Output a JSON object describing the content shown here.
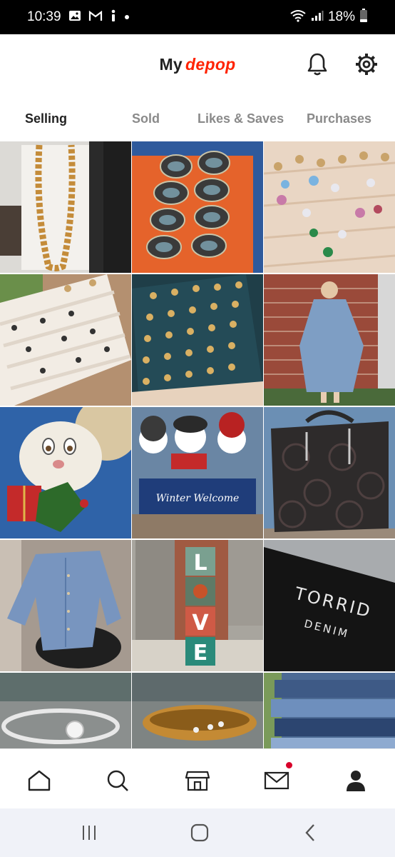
{
  "status_bar": {
    "time": "10:39",
    "battery": "18%",
    "left_icons": [
      "image-icon",
      "gmail-icon",
      "info-icon",
      "dot-icon"
    ],
    "right_icons": [
      "wifi-icon",
      "signal-icon",
      "battery-icon"
    ]
  },
  "header": {
    "title_prefix": "My",
    "brand": "depop",
    "brand_color": "#ff2300"
  },
  "tabs": [
    {
      "label": "Selling",
      "active": true
    },
    {
      "label": "Sold",
      "active": false
    },
    {
      "label": "Likes & Saves",
      "active": false
    },
    {
      "label": "Purchases",
      "active": false
    }
  ],
  "listings": [
    {
      "name": "gold-chain-necklace"
    },
    {
      "name": "compact-cases"
    },
    {
      "name": "rings-box"
    },
    {
      "name": "rings-tray"
    },
    {
      "name": "gold-rings-tray"
    },
    {
      "name": "denim-dress"
    },
    {
      "name": "christmas-bunny"
    },
    {
      "name": "snowmen-box",
      "text": "Winter Welcome"
    },
    {
      "name": "black-handbag"
    },
    {
      "name": "denim-jacket"
    },
    {
      "name": "love-sign",
      "text": [
        "L",
        "V",
        "E"
      ]
    },
    {
      "name": "torrid-label",
      "text": [
        "TORRID",
        "DENIM"
      ]
    },
    {
      "name": "diamond-ring"
    },
    {
      "name": "gold-ring"
    },
    {
      "name": "jeans-stack"
    }
  ],
  "bottom_nav": [
    "home-icon",
    "search-icon",
    "shop-icon",
    "inbox-icon",
    "profile-icon"
  ],
  "accent": "#d8002a"
}
